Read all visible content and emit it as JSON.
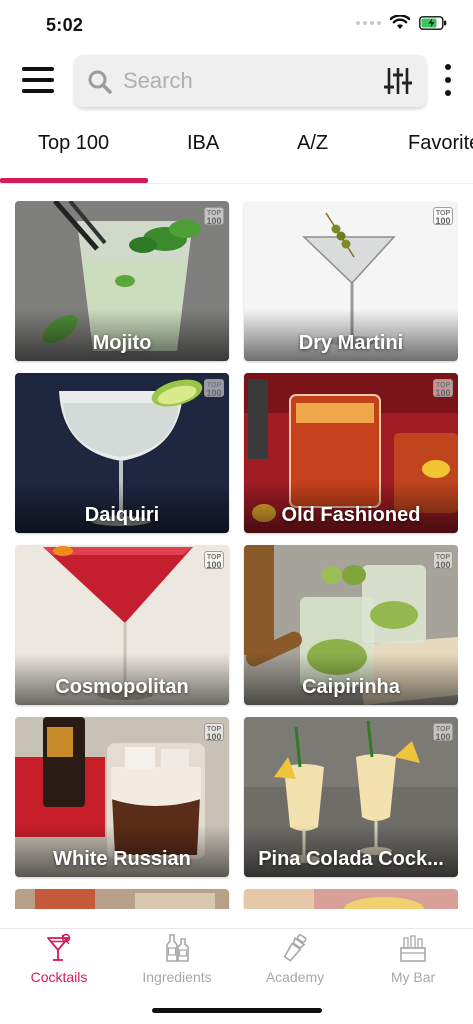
{
  "status_bar": {
    "time": "5:02"
  },
  "search": {
    "placeholder": "Search"
  },
  "tabs": [
    {
      "label": "Top 100",
      "active": true
    },
    {
      "label": "IBA",
      "active": false
    },
    {
      "label": "A/Z",
      "active": false
    },
    {
      "label": "Favorites",
      "active": false
    }
  ],
  "cocktails": [
    {
      "name": "Mojito",
      "badge": "100"
    },
    {
      "name": "Dry Martini",
      "badge": "100"
    },
    {
      "name": "Daiquiri",
      "badge": "100"
    },
    {
      "name": "Old Fashioned",
      "badge": "100"
    },
    {
      "name": "Cosmopolitan",
      "badge": "100"
    },
    {
      "name": "Caipirinha",
      "badge": "100"
    },
    {
      "name": "White Russian",
      "badge": "100"
    },
    {
      "name": "Pina Colada Cock...",
      "badge": "100"
    }
  ],
  "bottom_nav": [
    {
      "label": "Cocktails",
      "icon": "cocktail-glass-icon",
      "active": true
    },
    {
      "label": "Ingredients",
      "icon": "bottles-icon",
      "active": false
    },
    {
      "label": "Academy",
      "icon": "shaker-icon",
      "active": false
    },
    {
      "label": "My Bar",
      "icon": "bar-icon",
      "active": false
    }
  ],
  "colors": {
    "accent": "#d6195b",
    "inactive": "#a8a8a8"
  }
}
